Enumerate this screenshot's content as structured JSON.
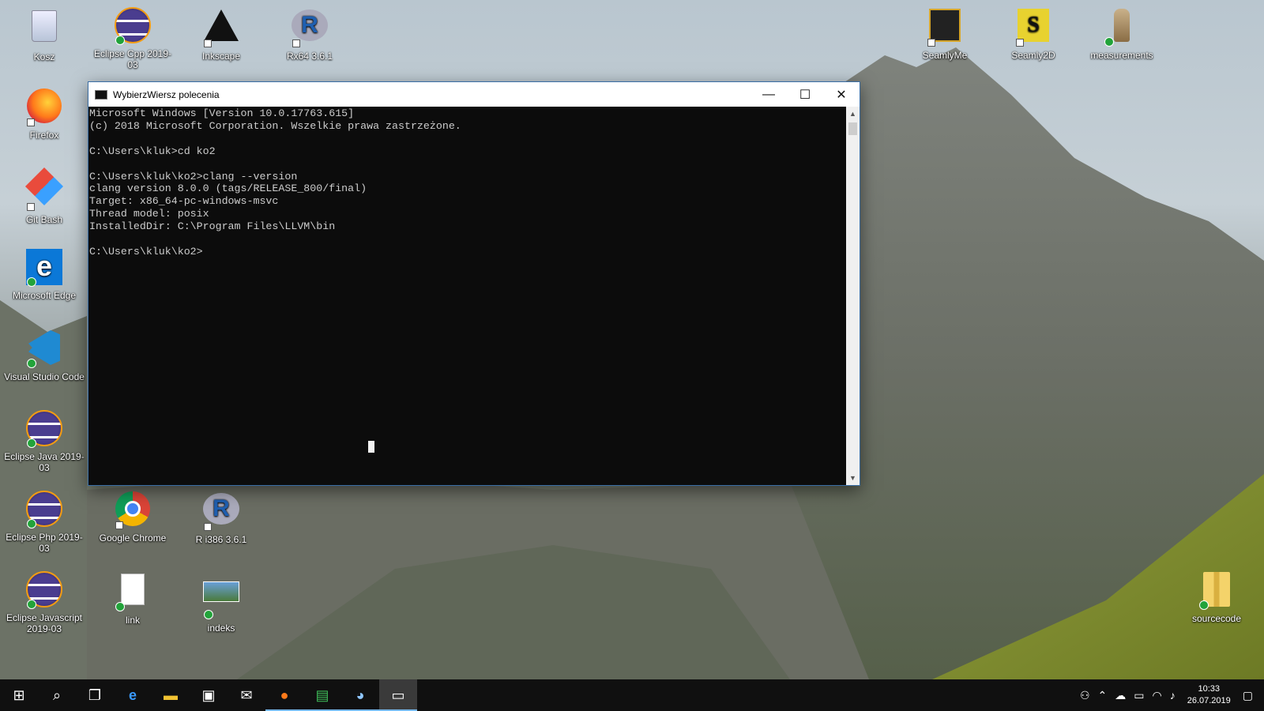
{
  "desktop": {
    "icons": [
      {
        "label": "Kosz"
      },
      {
        "label": "Eclipse Cpp 2019-03"
      },
      {
        "label": "Inkscape"
      },
      {
        "label": "Rx64 3.6.1"
      },
      {
        "label": "SeamlyMe"
      },
      {
        "label": "Seamly2D"
      },
      {
        "label": "measurements"
      },
      {
        "label": "Firefox"
      },
      {
        "label": "Git Bash"
      },
      {
        "label": "Microsoft Edge"
      },
      {
        "label": "Visual Studio Code"
      },
      {
        "label": "Eclipse Java 2019-03"
      },
      {
        "label": "Eclipse Php 2019-03"
      },
      {
        "label": "Google Chrome"
      },
      {
        "label": "R i386 3.6.1"
      },
      {
        "label": "Eclipse Javascript 2019-03"
      },
      {
        "label": "link"
      },
      {
        "label": "indeks"
      },
      {
        "label": "sourcecode"
      }
    ]
  },
  "window": {
    "title": "WybierzWiersz polecenia",
    "minimize": "—",
    "maximize": "☐",
    "close": "✕",
    "console_text": "Microsoft Windows [Version 10.0.17763.615]\n(c) 2018 Microsoft Corporation. Wszelkie prawa zastrzeżone.\n\nC:\\Users\\kluk>cd ko2\n\nC:\\Users\\kluk\\ko2>clang --version\nclang version 8.0.0 (tags/RELEASE_800/final)\nTarget: x86_64-pc-windows-msvc\nThread model: posix\nInstalledDir: C:\\Program Files\\LLVM\\bin\n\nC:\\Users\\kluk\\ko2>"
  },
  "taskbar": {
    "items": [
      {
        "name": "start-button",
        "glyph": "⊞"
      },
      {
        "name": "search-button",
        "glyph": "⌕"
      },
      {
        "name": "task-view-button",
        "glyph": "❐"
      },
      {
        "name": "edge-taskbar",
        "glyph": "e"
      },
      {
        "name": "file-explorer-taskbar",
        "glyph": "▬"
      },
      {
        "name": "store-taskbar",
        "glyph": "▣"
      },
      {
        "name": "mail-taskbar",
        "glyph": "✉"
      },
      {
        "name": "firefox-taskbar",
        "glyph": "●"
      },
      {
        "name": "spreadsheet-taskbar",
        "glyph": "▤"
      },
      {
        "name": "paint-taskbar",
        "glyph": "◕"
      },
      {
        "name": "cmd-taskbar",
        "glyph": "▭"
      }
    ],
    "clock_time": "10:33",
    "clock_date": "26.07.2019"
  }
}
